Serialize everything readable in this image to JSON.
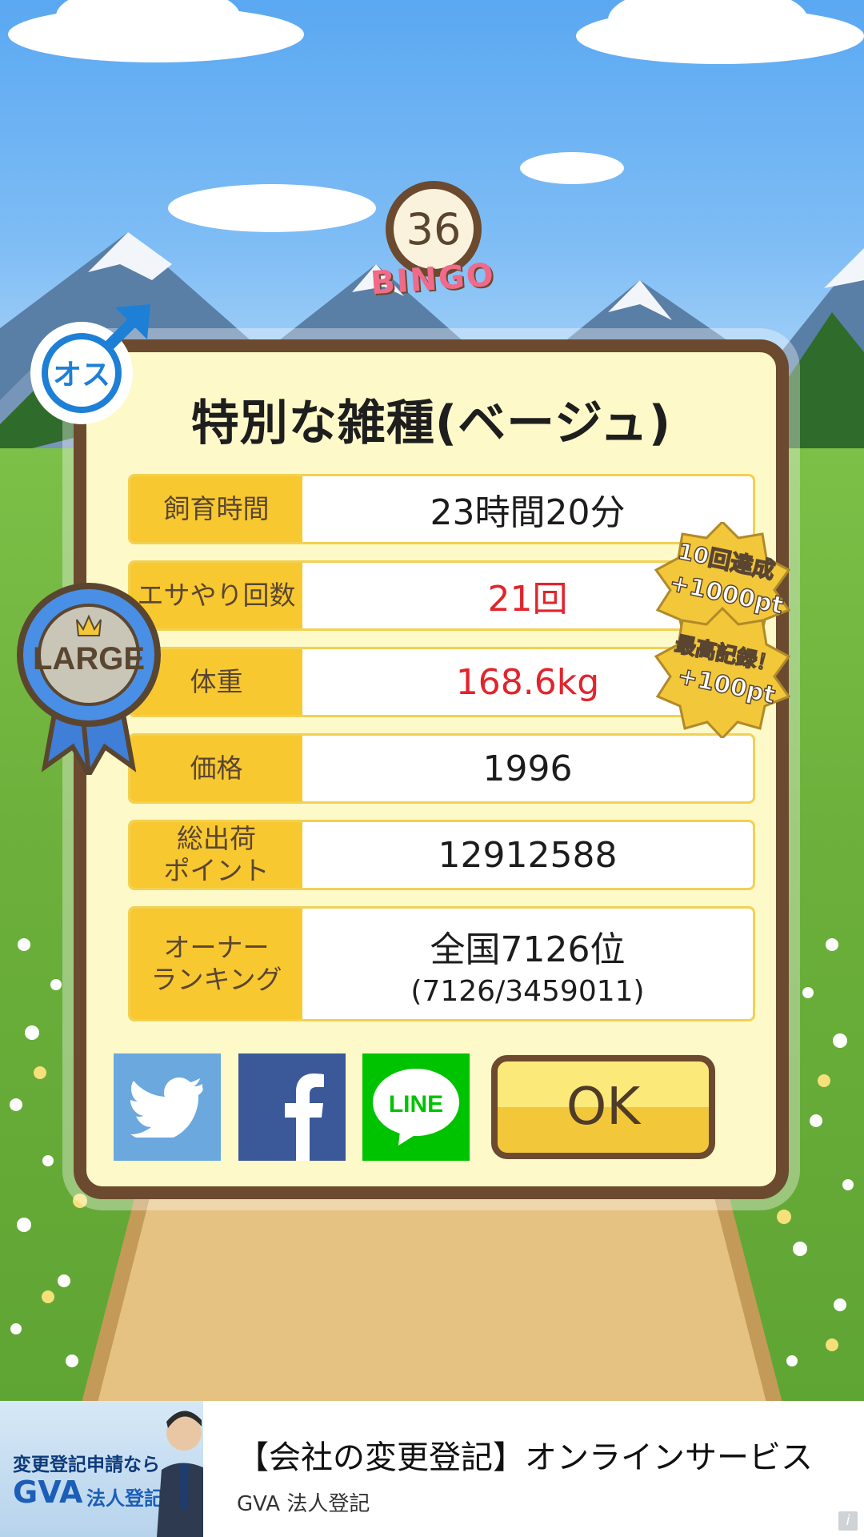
{
  "badge": {
    "number": "36",
    "word": "BINGO",
    "gender_mark": "オス",
    "size_award": "LARGE"
  },
  "achievements": [
    "10回達成",
    "+1000pt",
    "最高記録！",
    "+100pt"
  ],
  "dialog": {
    "title": "特別な雑種(ベージュ)",
    "rows": [
      {
        "label": "飼育時間",
        "value": "23時間20分"
      },
      {
        "label": "エサやり回数",
        "value": "21回"
      },
      {
        "label": "体重",
        "value": "168.6kg"
      },
      {
        "label": "価格",
        "value": "1996"
      },
      {
        "label": "総出荷\nポイント",
        "value": "12912588"
      },
      {
        "label": "オーナー\nランキング",
        "value": "全国7126位",
        "sub": "(7126/3459011)"
      }
    ],
    "share": {
      "line_label": "LINE"
    },
    "ok_label": "OK"
  },
  "colors": {
    "label_bg": "#f8c830",
    "highlight_red": "#e2242b",
    "frame_brown": "#6b4a2f",
    "panel_bg": "#fdf9c8"
  },
  "icons": [
    "bingo-ball-icon",
    "male-symbol-icon",
    "ribbon-award-icon",
    "star-badge-icon",
    "twitter-icon",
    "facebook-icon",
    "line-icon",
    "info-icon"
  ],
  "ad": {
    "image_line1": "変更登記申請なら",
    "image_brand": "GVA",
    "image_brand_sub": "法人登記",
    "title": "【会社の変更登記】オンラインサービス",
    "advertiser": "GVA 法人登記",
    "info_glyph": "i"
  }
}
